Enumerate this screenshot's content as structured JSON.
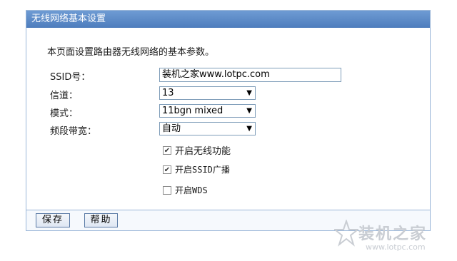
{
  "panel": {
    "title": "无线网络基本设置",
    "description": "本页面设置路由器无线网络的基本参数。"
  },
  "fields": {
    "ssid_label": "SSID号：",
    "ssid_value": "装机之家www.lotpc.com",
    "channel_label": "信道：",
    "channel_value": "13",
    "mode_label": "模式：",
    "mode_value": "11bgn mixed",
    "bandwidth_label": "频段带宽：",
    "bandwidth_value": "自动"
  },
  "options": {
    "enable_wireless": {
      "label": "开启无线功能",
      "checked": true
    },
    "enable_ssid_broadcast": {
      "label": "开启SSID广播",
      "checked": true
    },
    "enable_wds": {
      "label": "开启WDS",
      "checked": false
    }
  },
  "buttons": {
    "save": "保存",
    "help": "帮助"
  },
  "watermark": {
    "brand": "装机之家",
    "url": "www.lotpc.com"
  },
  "colors": {
    "title_bar": "#5b8ac7",
    "border": "#9ab6d8"
  },
  "icons": {
    "dropdown": "triangle-down",
    "checkmark": "check"
  }
}
